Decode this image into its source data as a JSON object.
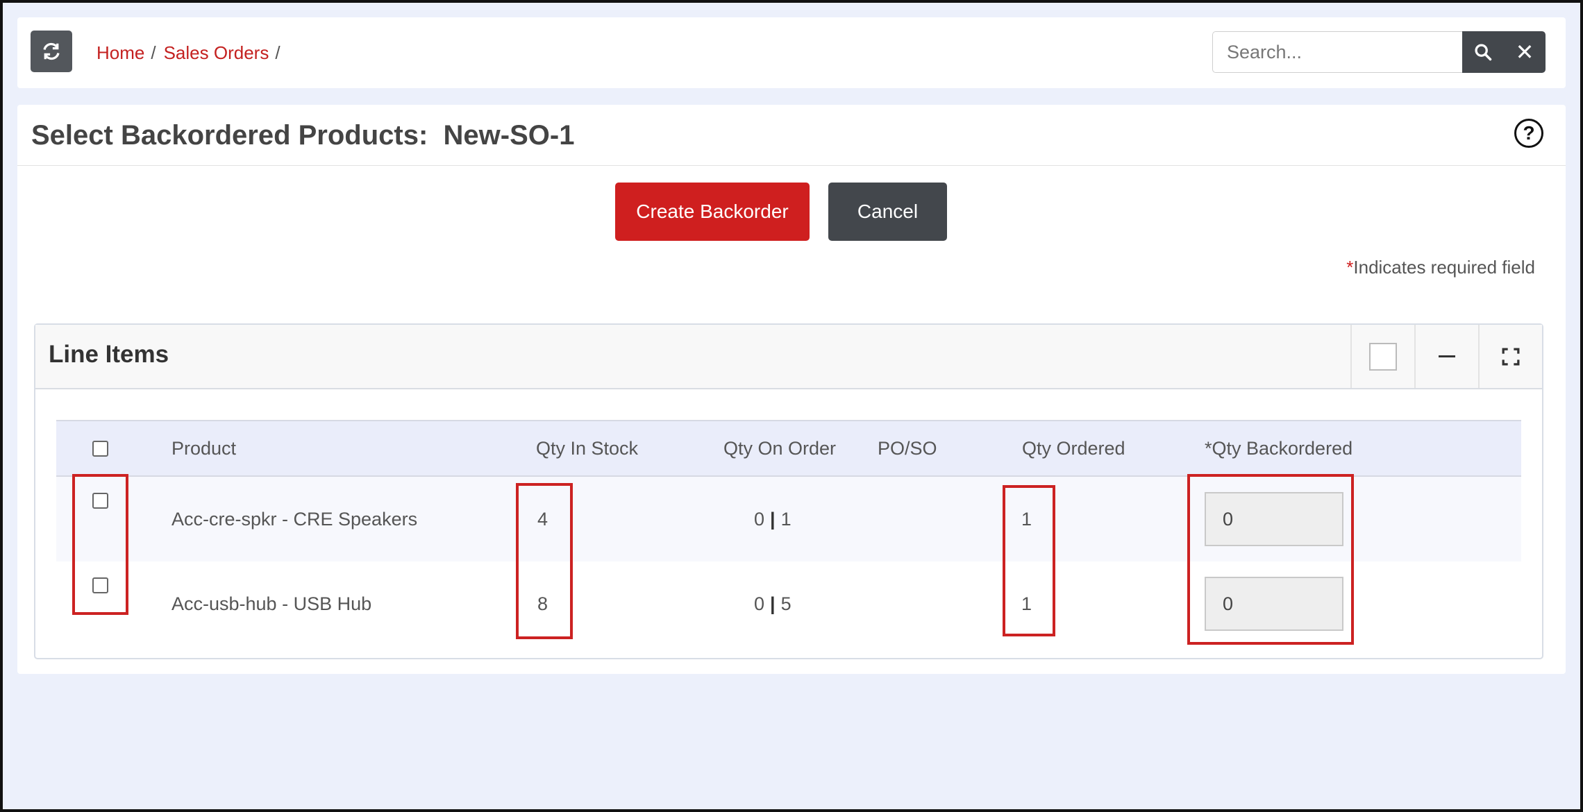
{
  "breadcrumb": {
    "home": "Home",
    "sales_orders": "Sales Orders",
    "separator": "/"
  },
  "search": {
    "placeholder": "Search...",
    "clear_symbol": "✕"
  },
  "page": {
    "title": "Select Backordered Products:  New-SO-1",
    "help_symbol": "?"
  },
  "actions": {
    "create_label": "Create Backorder",
    "cancel_label": "Cancel"
  },
  "required_note": {
    "star": "*",
    "text": "Indicates required field"
  },
  "line_items": {
    "title": "Line Items",
    "columns": {
      "product": "Product",
      "qty_in_stock": "Qty In Stock",
      "qty_on_order": "Qty On Order",
      "po_so": "PO/SO",
      "qty_ordered": "Qty Ordered",
      "qty_backordered": "*Qty Backordered"
    },
    "rows": [
      {
        "product": "Acc-cre-spkr - CRE Speakers",
        "qty_in_stock": "4",
        "on_order_a": "0",
        "on_order_b": "1",
        "po_so": "",
        "qty_ordered": "1",
        "qty_backordered": "0",
        "checked": false
      },
      {
        "product": "Acc-usb-hub - USB Hub",
        "qty_in_stock": "8",
        "on_order_a": "0",
        "on_order_b": "5",
        "po_so": "",
        "qty_ordered": "1",
        "qty_backordered": "0",
        "checked": false
      }
    ]
  },
  "colors": {
    "accent_red": "#cf1f1f",
    "dark_button": "#43474c",
    "link_red": "#c42120",
    "highlight_red": "#cc2222",
    "page_bg": "#ecf0fb"
  }
}
